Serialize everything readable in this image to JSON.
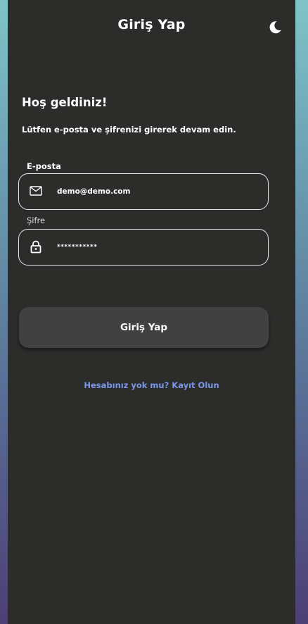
{
  "header": {
    "title": "Giriş Yap",
    "theme_icon": "moon-icon"
  },
  "welcome": {
    "title": "Hoş geldiniz!",
    "subtitle": "Lütfen e-posta ve şifrenizi girerek devam edin."
  },
  "form": {
    "email": {
      "label": "E-posta",
      "value": "demo@demo.com",
      "icon": "mail-icon"
    },
    "password": {
      "label": "Şifre",
      "value": "***********",
      "icon": "lock-icon"
    },
    "submit_label": "Giriş Yap"
  },
  "signup": {
    "link_text": "Hesabınız yok mu? Kayıt Olun"
  },
  "colors": {
    "background": "#2c2d2b",
    "button": "#414141",
    "link": "#7b96e8",
    "text": "#ffffff"
  }
}
